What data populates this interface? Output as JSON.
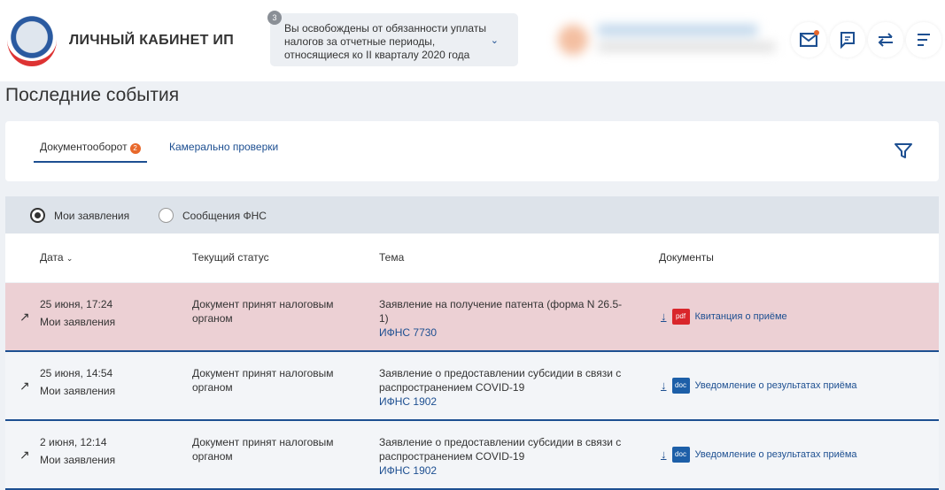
{
  "header": {
    "brand": "ЛИЧНЫЙ КАБИНЕТ ИП",
    "notice_count": "3",
    "notice_text": "Вы освобождены от обязанности уплаты налогов за отчетные периоды, относящиеся ко II кварталу 2020 года"
  },
  "page_title": "Последние события",
  "tabs": [
    {
      "label": "Документооборот",
      "badge": "2"
    },
    {
      "label": "Камерально проверки"
    }
  ],
  "radios": [
    {
      "label": "Мои заявления",
      "checked": true
    },
    {
      "label": "Сообщения ФНС",
      "checked": false
    }
  ],
  "columns": [
    "Дата",
    "Текущий статус",
    "Тема",
    "Документы"
  ],
  "rows": [
    {
      "date": "25 июня, 17:24",
      "source": "Мои заявления",
      "status": "Документ принят налоговым органом",
      "topic": "Заявление на получение патента (форма N 26.5-1)",
      "ifns": "ИФНС 7730",
      "file_type": "pdf",
      "doc": "Квитанция о приёме",
      "bg": "#ecd0d4"
    },
    {
      "date": "25 июня, 14:54",
      "source": "Мои заявления",
      "status": "Документ принят налоговым органом",
      "topic": "Заявление о предоставлении субсидии в связи с распространением COVID-19",
      "ifns": "ИФНС 1902",
      "file_type": "doc",
      "doc": "Уведомление о результатах приёма",
      "bg": "#f3f5f8"
    },
    {
      "date": "2 июня, 12:14",
      "source": "Мои заявления",
      "status": "Документ принят налоговым органом",
      "topic": "Заявление о предоставлении субсидии в связи с распространением COVID-19",
      "ifns": "ИФНС 1902",
      "file_type": "doc",
      "doc": "Уведомление о результатах приёма",
      "bg": "#f3f5f8"
    }
  ],
  "colors": {
    "accent": "#1d4f91",
    "badge": "#e8682b",
    "pdf": "#d9262b",
    "doc": "#1d5fa8"
  }
}
